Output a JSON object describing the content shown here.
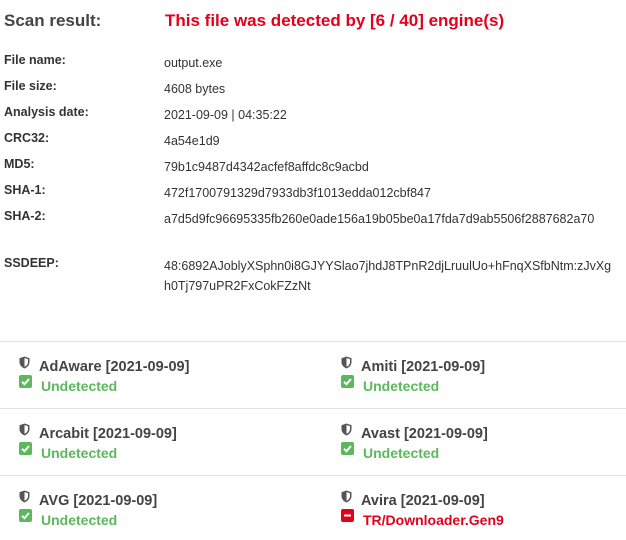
{
  "header": {
    "label": "Scan result:",
    "result": "This file was detected by [6 / 40] engine(s)"
  },
  "info": [
    {
      "key": "File name:",
      "value": "output.exe"
    },
    {
      "key": "File size:",
      "value": "4608 bytes"
    },
    {
      "key": "Analysis date:",
      "value": "2021-09-09 | 04:35:22"
    },
    {
      "key": "CRC32:",
      "value": "4a54e1d9"
    },
    {
      "key": "MD5:",
      "value": "79b1c9487d4342acfef8affdc8c9acbd"
    },
    {
      "key": "SHA-1:",
      "value": "472f1700791329d7933db3f1013edda012cbf847"
    },
    {
      "key": "SHA-2:",
      "value": "a7d5d9fc96695335fb260e0ade156a19b05be0a17fda7d9ab5506f2887682a70"
    },
    {
      "key": "SSDEEP:",
      "value": "48:6892AJoblyXSphn0i8GJYYSlao7jhdJ8TPnR2djLruulUo+hFnqXSfbNtm:zJvXgh0Tj797uPR2FxCokFZzNt"
    }
  ],
  "engines": [
    {
      "name": "AdAware [2021-09-09]",
      "status": "Undetected",
      "detected": false
    },
    {
      "name": "Amiti [2021-09-09]",
      "status": "Undetected",
      "detected": false
    },
    {
      "name": "Arcabit [2021-09-09]",
      "status": "Undetected",
      "detected": false
    },
    {
      "name": "Avast [2021-09-09]",
      "status": "Undetected",
      "detected": false
    },
    {
      "name": "AVG [2021-09-09]",
      "status": "Undetected",
      "detected": false
    },
    {
      "name": "Avira [2021-09-09]",
      "status": "TR/Downloader.Gen9",
      "detected": true
    }
  ],
  "colors": {
    "detected": "#e3001b",
    "undetected": "#5cb85c",
    "shield": "#555555"
  },
  "icons": {
    "engine": "shield-icon",
    "undetected": "check-icon",
    "detected": "minus-icon"
  }
}
